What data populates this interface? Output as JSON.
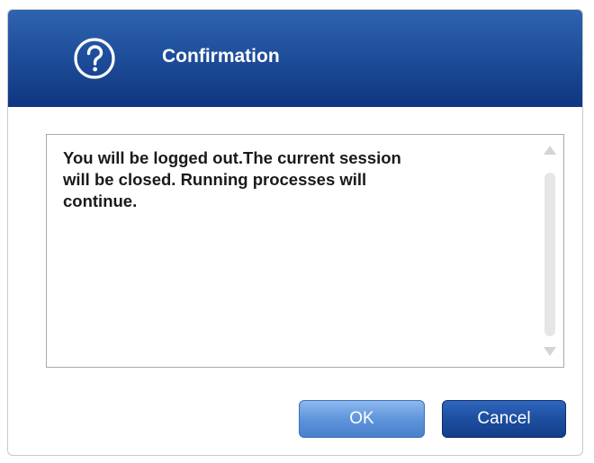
{
  "dialog": {
    "title": "Confirmation",
    "icon": "question-circle-icon",
    "message": "You will be logged out.The current session\nwill be closed. Running processes will\ncontinue.",
    "buttons": {
      "ok_label": "OK",
      "cancel_label": "Cancel"
    }
  },
  "colors": {
    "titlebar": "#1f4f9c",
    "ok_button": "#5f95dc",
    "cancel_button": "#1d4e9f"
  }
}
